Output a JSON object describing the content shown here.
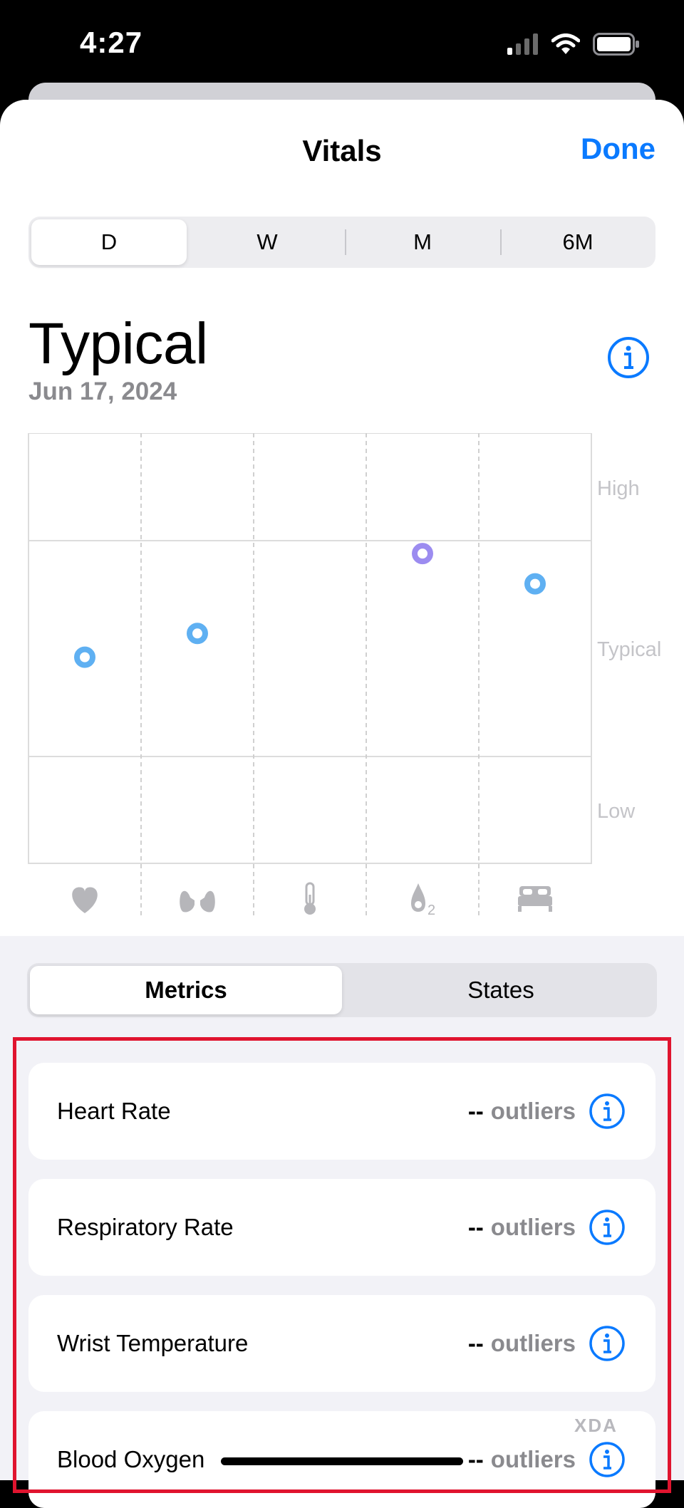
{
  "status": {
    "time": "4:27"
  },
  "nav": {
    "title": "Vitals",
    "done_label": "Done"
  },
  "range": {
    "options": [
      "D",
      "W",
      "M",
      "6M"
    ],
    "selected": "D"
  },
  "summary": {
    "status": "Typical",
    "date": "Jun 17, 2024"
  },
  "chart_data": {
    "type": "scatter",
    "y_bands": [
      "High",
      "Typical",
      "Low"
    ],
    "categories": [
      "heart-icon",
      "lungs-icon",
      "thermometer-icon",
      "oxygen-drop-icon",
      "bed-icon"
    ],
    "points": [
      {
        "category": "heart-icon",
        "value": 0.46,
        "color": "#5fb0f2"
      },
      {
        "category": "lungs-icon",
        "value": 0.57,
        "color": "#5fb0f2"
      },
      {
        "category": "oxygen-drop-icon",
        "value": 0.94,
        "color": "#9c8cf0"
      },
      {
        "category": "bed-icon",
        "value": 0.8,
        "color": "#5fb0f2"
      }
    ],
    "value_note": "0 = bottom of Typical band, 1 = top of Typical band"
  },
  "tabs": {
    "metrics_label": "Metrics",
    "states_label": "States",
    "selected": "Metrics"
  },
  "metrics": [
    {
      "label": "Heart Rate",
      "value": "--",
      "unit": "outliers"
    },
    {
      "label": "Respiratory Rate",
      "value": "--",
      "unit": "outliers"
    },
    {
      "label": "Wrist Temperature",
      "value": "--",
      "unit": "outliers"
    },
    {
      "label": "Blood Oxygen",
      "value": "--",
      "unit": "outliers"
    }
  ],
  "watermark": "XDA",
  "colors": {
    "accent": "#0a7aff",
    "highlight": "#e0142f",
    "point": "#5fb0f2",
    "point_oxygen": "#9c8cf0"
  }
}
